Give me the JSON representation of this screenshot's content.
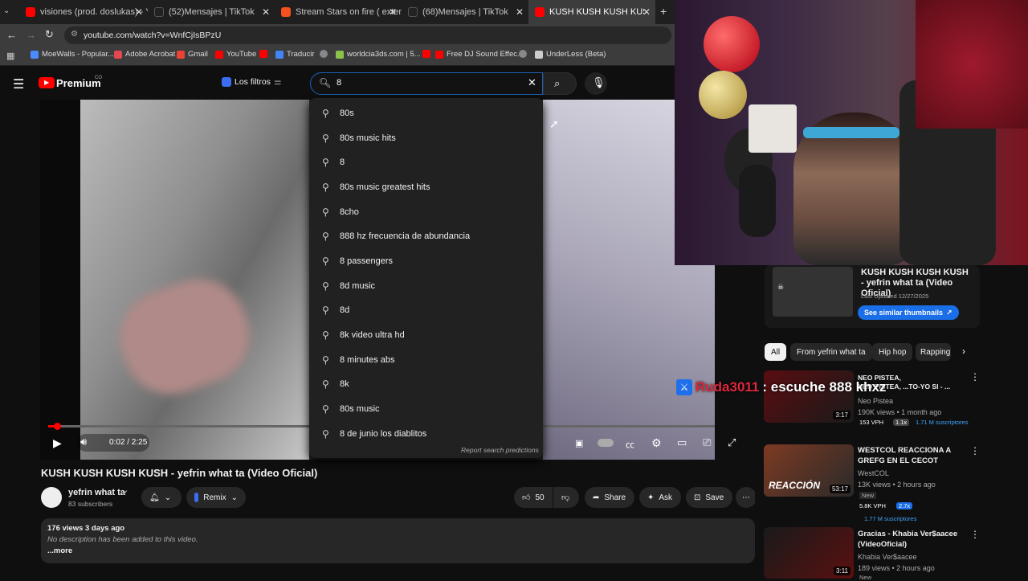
{
  "browser": {
    "tabs": [
      {
        "label": "visiones (prod. doslukas) - YouT",
        "color": "#ff0000"
      },
      {
        "label": "(52)Mensajes | TikTok",
        "color": "#222222"
      },
      {
        "label": "Stream Stars on fire ( extended",
        "color": "#f4511e"
      },
      {
        "label": "(68)Mensajes | TikTok",
        "color": "#222222"
      },
      {
        "label": "KUSH KUSH KUSH KUSH - yefri",
        "color": "#ff0000"
      }
    ],
    "new_tab": "+",
    "url": "youtube.com/watch?v=WnfCjIsBPzU",
    "bookmarks": [
      {
        "label": "MoeWalls - Popular...",
        "color": "#4a8cff"
      },
      {
        "label": "Adobe Acrobat",
        "color": "#e34850"
      },
      {
        "label": "Gmail",
        "color": "#ea4335"
      },
      {
        "label": "YouTube",
        "color": "#ff0000"
      },
      {
        "label": "",
        "color": "#ff0000"
      },
      {
        "label": "Traducir",
        "color": "#4285f4"
      },
      {
        "label": "worldcia3ds.com | 5...",
        "color": "#888888"
      },
      {
        "label": "",
        "color": "#8bc34a"
      },
      {
        "label": "Free DJ Sound Effec...",
        "color": "#ff0000"
      },
      {
        "label": "",
        "color": "#888888"
      },
      {
        "label": "UnderLess (Beta)",
        "color": "#cccccc"
      }
    ]
  },
  "yt": {
    "logo": "Premium",
    "logo_sup": "CO",
    "filters": "Los filtros",
    "search_value": "8",
    "suggestions": [
      "80s",
      "80s music hits",
      "8",
      "80s music greatest hits",
      "8cho",
      "888 hz frecuencia de abundancia",
      "8 passengers",
      "8d music",
      "8d",
      "8k video ultra hd",
      "8 minutes abs",
      "8k",
      "80s music",
      "8 de junio los diablitos"
    ],
    "report": "Report search predictions"
  },
  "player": {
    "time": "0:02 / 2:25"
  },
  "video": {
    "title": "KUSH KUSH KUSH KUSH - yefrin what ta (Video Oficial)",
    "channel": "yefrin what ta",
    "subs": "83 subscribers",
    "remix": "Remix",
    "likes": "50",
    "share": "Share",
    "ask": "Ask",
    "save": "Save",
    "views": "176 views  3 days ago",
    "desc": "No description has been added to this video.",
    "more": "...more"
  },
  "sidebar": {
    "thumbnail_card": {
      "title": "KUSH KUSH KUSH KUSH - yefrin what ta (Video Oficial)",
      "updated": "Last Updated 12/27/2025",
      "button": "See similar thumbnails"
    },
    "chips": [
      "All",
      "From yefrin what ta",
      "Hip hop",
      "Rapping"
    ],
    "items": [
      {
        "title": "NEO PISTEA, ...TO-YO SI - ...",
        "channel": "Neo Pistea",
        "meta": "190K views • 1 month ago",
        "vph": "153 VPH",
        "mult": "1.1x",
        "subs": "1.71 M suscriptores",
        "duration": "3:17",
        "new": ""
      },
      {
        "title": "WESTCOL REACCIONA A GREFG EN EL CECOT",
        "channel": "WestCOL",
        "meta": "13K views • 2 hours ago",
        "vph": "5.8K VPH",
        "mult": "2.7x",
        "subs": "1.77 M suscriptores",
        "duration": "53:17",
        "new": "New"
      },
      {
        "title": "Gracias - Khabia Ver$aacee (VideoOficial)",
        "channel": "Khabia Ver$aacee",
        "meta": "189 views • 2 hours ago",
        "vph": "",
        "mult": "",
        "subs": "",
        "duration": "3:11",
        "new": "New"
      }
    ]
  },
  "chat_overlay": {
    "user": "Ruda3011",
    "message": ": escuche 888 khxz"
  },
  "colors": {
    "accent": "#3ea6ff",
    "red": "#ff0000",
    "chat_user": "#e0273d"
  }
}
